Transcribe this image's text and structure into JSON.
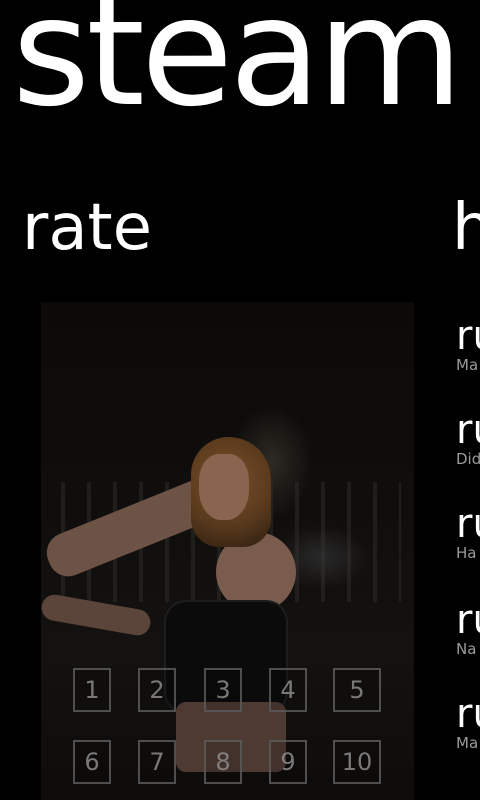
{
  "app": {
    "title": "steam"
  },
  "pivot": {
    "items": [
      {
        "label": "rate"
      },
      {
        "label": "h"
      }
    ]
  },
  "rate": {
    "photo_alt": "",
    "buttons": [
      "1",
      "2",
      "3",
      "4",
      "5",
      "6",
      "7",
      "8",
      "9",
      "10"
    ]
  },
  "history": {
    "items": [
      {
        "title": "ru",
        "subtitle": "Ma"
      },
      {
        "title": "ru",
        "subtitle": "Did"
      },
      {
        "title": "ru",
        "subtitle": "Ha"
      },
      {
        "title": "ru",
        "subtitle": "Na"
      },
      {
        "title": "ru",
        "subtitle": "Ma"
      }
    ]
  },
  "colors": {
    "background": "#000000",
    "foreground": "#ffffff",
    "subtle_text": "#9a9a9a",
    "button_border": "#5a5a5a"
  }
}
